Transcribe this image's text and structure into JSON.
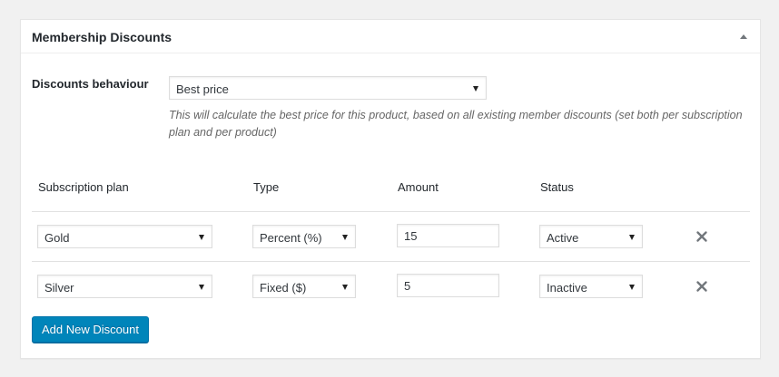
{
  "panel": {
    "title": "Membership Discounts"
  },
  "behaviour": {
    "label": "Discounts behaviour",
    "selected": "Best price",
    "description": "This will calculate the best price for this product, based on all existing member discounts (set both per subscription plan and per product)"
  },
  "table": {
    "headers": {
      "plan": "Subscription plan",
      "type": "Type",
      "amount": "Amount",
      "status": "Status"
    },
    "rows": [
      {
        "plan": "Gold",
        "type": "Percent (%)",
        "amount": "15",
        "status": "Active"
      },
      {
        "plan": "Silver",
        "type": "Fixed ($)",
        "amount": "5",
        "status": "Inactive"
      }
    ]
  },
  "actions": {
    "add_label": "Add New Discount"
  },
  "icons": {
    "toggle": "triangle-up-icon",
    "remove": "close-icon"
  },
  "colors": {
    "primary_button": "#0085ba",
    "remove_icon": "#72777c"
  }
}
